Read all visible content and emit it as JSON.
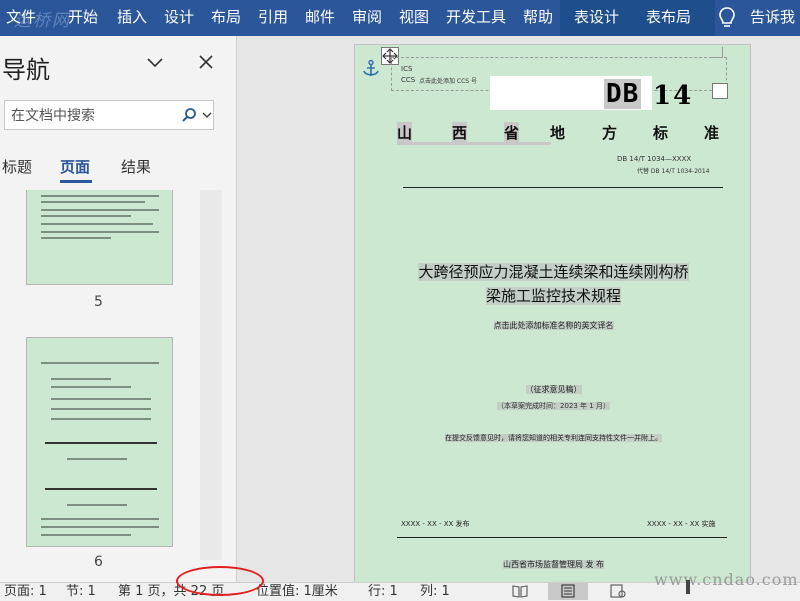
{
  "ribbon": {
    "tabs": [
      "文件",
      "开始",
      "插入",
      "设计",
      "布局",
      "引用",
      "邮件",
      "审阅",
      "视图",
      "开发工具",
      "帮助"
    ],
    "context_tabs": [
      "表设计",
      "表布局"
    ],
    "tell_me": "告诉我",
    "watermark": "运桥网",
    "bg_color": "#2b579a"
  },
  "nav": {
    "title": "导航",
    "search_placeholder": "在文档中搜索",
    "tabs": [
      "标题",
      "页面",
      "结果"
    ],
    "active_tab": "页面",
    "thumb_pages": [
      "5",
      "6"
    ]
  },
  "document": {
    "ics": "ICS",
    "ccs": "CCS",
    "ccs_note": "点击此处添加 CCS 号",
    "db_logo": "DB",
    "db_number": "14",
    "standard_header": [
      "山",
      "西",
      "省",
      "地",
      "方",
      "标",
      "准"
    ],
    "code": "DB 14/T  1034—XXXX",
    "replaces": "代替  DB 14/T  1034-2014",
    "title_line1": "大跨径预应力混凝土连续梁和连续刚构桥",
    "title_line2": "梁施工监控技术规程",
    "english_title": "点击此处添加标准名称的英文译名",
    "draft_stage": "（征求意见稿）",
    "completion": "（本草案完成时间：2023 年 1 月）",
    "feedback_note": "在提交反馈意见时，请将您知道的相关专利连同支持性文件一并附上。",
    "issue_date": "XXXX - XX - XX 发布",
    "implement_date": "XXXX - XX - XX 实施",
    "publisher": "山西省市场监督管理局    发  布",
    "page_color": "#cde8d0"
  },
  "status": {
    "page": "页面: 1",
    "section": "节: 1",
    "page_of": "第 1 页，共 22 页",
    "position": "位置值: 1厘米",
    "line": "行: 1",
    "column": "列: 1",
    "site_watermark": "www.cndao.com"
  }
}
